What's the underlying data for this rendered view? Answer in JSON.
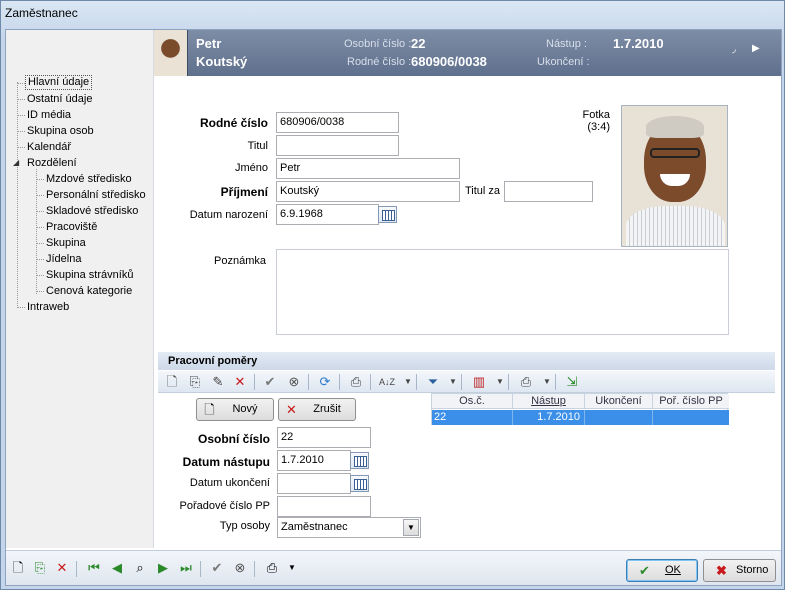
{
  "window": {
    "title": "Zaměstnanec"
  },
  "nav": {
    "items": [
      {
        "label": "Hlavní údaje"
      },
      {
        "label": "Ostatní údaje"
      },
      {
        "label": "ID média"
      },
      {
        "label": "Skupina osob"
      },
      {
        "label": "Kalendář"
      },
      {
        "label": "Rozdělení"
      },
      {
        "label": "Mzdové středisko"
      },
      {
        "label": "Personální středisko"
      },
      {
        "label": "Skladové středisko"
      },
      {
        "label": "Pracoviště"
      },
      {
        "label": "Skupina"
      },
      {
        "label": "Jídelna"
      },
      {
        "label": "Skupina strávníků"
      },
      {
        "label": "Cenová kategorie"
      },
      {
        "label": "Intraweb"
      }
    ]
  },
  "header": {
    "first_name": "Petr",
    "last_name": "Koutský",
    "osobni_cislo_label": "Osobní číslo :",
    "osobni_cislo_value": "22",
    "rodne_cislo_label": "Rodné číslo :",
    "rodne_cislo_value": "680906/0038",
    "nastup_label": "Nástup :",
    "nastup_value": "1.7.2010",
    "ukonceni_label": "Ukončení :",
    "ukonceni_value": ""
  },
  "form": {
    "rodne_cislo": {
      "label": "Rodné číslo",
      "value": "680906/0038"
    },
    "titul": {
      "label": "Titul",
      "value": ""
    },
    "jmeno": {
      "label": "Jméno",
      "value": "Petr"
    },
    "prijmeni": {
      "label": "Příjmení",
      "value": "Koutský"
    },
    "titul_za": {
      "label": "Titul za",
      "value": ""
    },
    "datum_narozeni": {
      "label": "Datum narození",
      "value": "6.9.1968"
    },
    "poznamka": {
      "label": "Poznámka",
      "value": ""
    },
    "fotka_label": "Fotka",
    "fotka_ratio": "(3:4)"
  },
  "pomery": {
    "section_title": "Pracovní poměry",
    "new_label": "Nový",
    "cancel_label": "Zrušit",
    "osobni_cislo": {
      "label": "Osobní číslo",
      "value": "22"
    },
    "datum_nastupu": {
      "label": "Datum nástupu",
      "value": "1.7.2010"
    },
    "datum_ukonceni": {
      "label": "Datum ukončení",
      "value": ""
    },
    "poradove_cislo": {
      "label": "Pořadové číslo PP",
      "value": ""
    },
    "typ_osoby": {
      "label": "Typ osoby",
      "value": "Zaměstnanec"
    },
    "grid": {
      "columns": [
        "Os.č.",
        "Nástup",
        "Ukončení",
        "Poř. číslo PP"
      ],
      "rows": [
        [
          "22",
          "1.7.2010",
          "",
          ""
        ]
      ]
    }
  },
  "footer": {
    "ok_label": "OK",
    "storno_label": "Storno"
  },
  "colors": {
    "header_bg": "#6c7c96",
    "selected_row": "#3b8fe8"
  }
}
